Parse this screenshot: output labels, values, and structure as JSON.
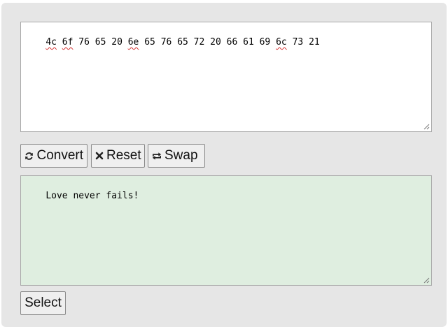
{
  "input": {
    "tokens": [
      "4c",
      "6f",
      "76",
      "65",
      "20",
      "6e",
      "65",
      "76",
      "65",
      "72",
      "20",
      "66",
      "61",
      "69",
      "6c",
      "73",
      "21"
    ],
    "spell_flagged": [
      0,
      1,
      5,
      14
    ]
  },
  "toolbar": {
    "convert_label": "Convert",
    "reset_label": "Reset",
    "swap_label": "Swap"
  },
  "output": {
    "value": "Love never fails!",
    "background": "#dfeee0"
  },
  "select_label": "Select"
}
